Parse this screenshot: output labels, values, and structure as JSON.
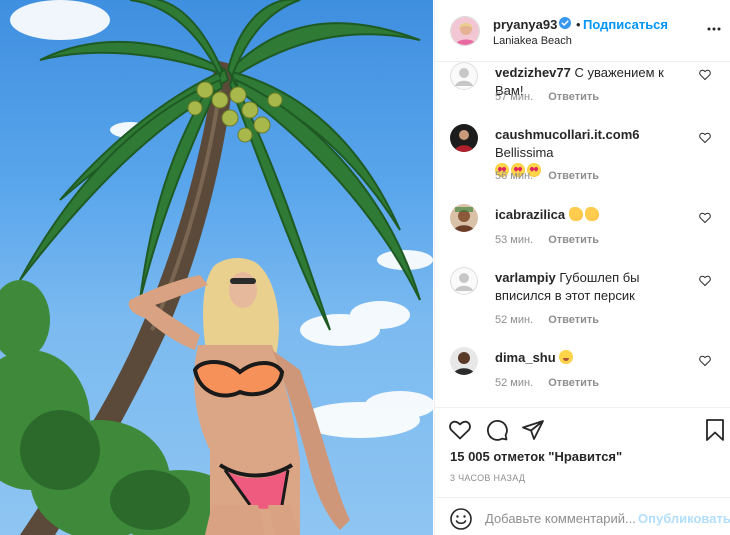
{
  "post": {
    "username": "pryanya93",
    "dot": "•",
    "follow_label": "Подписаться",
    "location": "Laniakea Beach",
    "verified": true,
    "more_icon": "more-horizontal-icon"
  },
  "comments": [
    {
      "user": "vedzizhev77",
      "text": "С уважением к Вам!",
      "emojis": [],
      "time": "57 мин.",
      "reply": "Ответить"
    },
    {
      "user": "caushmucollari.it.com6",
      "text": "Bellissima",
      "emojis": [
        "heart-eyes",
        "heart-eyes",
        "heart-eyes"
      ],
      "time": "56 мин.",
      "reply": "Ответить"
    },
    {
      "user": "icabrazilica",
      "text": "",
      "emojis": [
        "clap",
        "clap"
      ],
      "time": "53 мин.",
      "reply": "Ответить"
    },
    {
      "user": "varlampiy",
      "text": "Губошлеп бы вписился в этот персик",
      "emojis": [],
      "time": "52 мин.",
      "reply": "Ответить"
    },
    {
      "user": "dima_shu",
      "text": "",
      "emojis": [
        "drool"
      ],
      "time": "52 мин.",
      "reply": "Ответить"
    }
  ],
  "actions": {
    "likes": "15 005 отметок \"Нравится\"",
    "time": "3 ЧАСОВ НАЗАД"
  },
  "add_comment": {
    "placeholder": "Добавьте комментарий...",
    "publish_label": "Опубликовать"
  },
  "colors": {
    "accent": "#0095f6",
    "publish_disabled": "#b2dffc",
    "muted": "#8e8e8e",
    "text": "#262626",
    "verified": "#3897f0"
  }
}
